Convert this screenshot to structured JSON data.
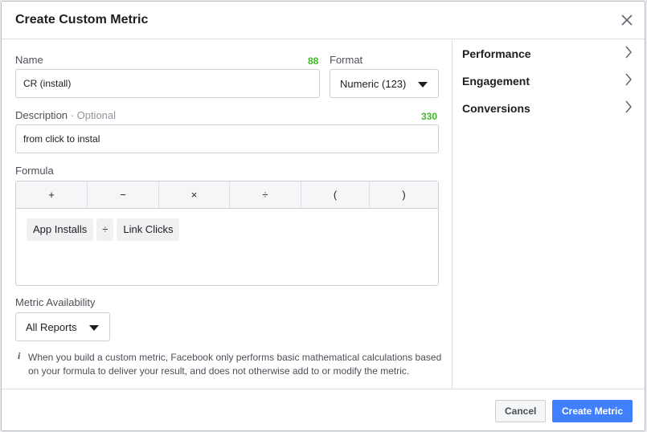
{
  "dialog": {
    "title": "Create Custom Metric",
    "close_icon": "close-icon"
  },
  "form": {
    "name": {
      "label": "Name",
      "value": "CR (install)",
      "remaining": "88"
    },
    "format": {
      "label": "Format",
      "value": "Numeric (123)"
    },
    "description": {
      "label": "Description",
      "optional": "· Optional",
      "value": "from click to instal",
      "remaining": "330"
    },
    "formula": {
      "label": "Formula",
      "operators": [
        "+",
        "−",
        "×",
        "÷",
        "(",
        ")"
      ],
      "tokens": [
        "App Installs",
        "÷",
        "Link Clicks"
      ]
    },
    "availability": {
      "label": "Metric Availability",
      "value": "All Reports"
    },
    "info": {
      "icon": "info-icon",
      "text": "When you build a custom metric, Facebook only performs basic mathematical calculations based on your formula to deliver your result, and does not otherwise add to or modify the metric."
    }
  },
  "categories": [
    {
      "label": "Performance",
      "icon": "chevron-right-icon"
    },
    {
      "label": "Engagement",
      "icon": "chevron-right-icon"
    },
    {
      "label": "Conversions",
      "icon": "chevron-right-icon"
    }
  ],
  "footer": {
    "cancel_label": "Cancel",
    "create_label": "Create Metric"
  },
  "colors": {
    "primary": "#4080ff",
    "counter_green": "#42b72a",
    "border": "#ccd0d5"
  }
}
